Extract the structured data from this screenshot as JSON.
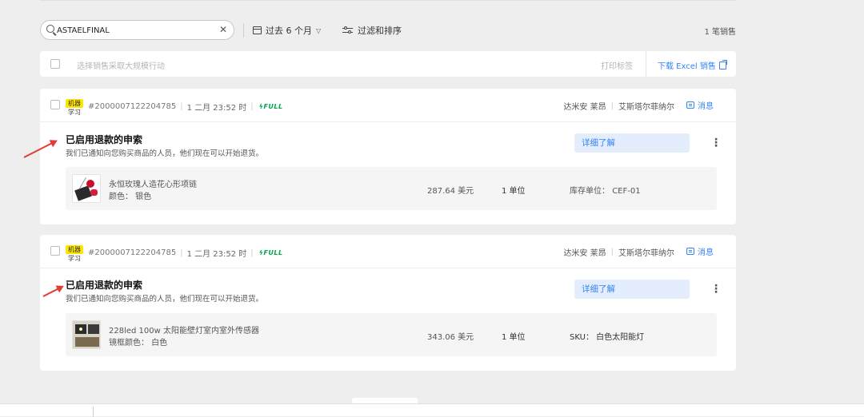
{
  "search": {
    "value": "ASTAELFINAL",
    "placeholder": ""
  },
  "period": {
    "label": "过去 6 个月"
  },
  "filter": {
    "label": "过滤和排序"
  },
  "sales_count": "1 笔销售",
  "bulk": {
    "hint": "选择销售采取大规模行动",
    "print_label": "打印标签",
    "excel_label": "下载 Excel 销售"
  },
  "orders": [
    {
      "tag_top": "机器",
      "tag_bottom": "学习",
      "order_number": "#2000007122204785",
      "datetime": "1 二月 23:52 时",
      "shipping": "FULL",
      "buyer_name": "达米安 莱昂",
      "buyer_alt": "艾斯塔尔菲纳尔",
      "message_label": "消息",
      "claim_title": "已启用退款的申索",
      "claim_desc": "我们已通知向您购买商品的人员，他们现在可以开始退货。",
      "learn_label": "详细了解",
      "item": {
        "name": "永恒玫瑰人造花心形项链",
        "variation": "颜色： 银色",
        "price": "287.64 美元",
        "units": "1 单位",
        "sku_label": "库存单位：",
        "sku_value": "CEF-01"
      }
    },
    {
      "tag_top": "机器",
      "tag_bottom": "学习",
      "order_number": "#2000007122204785",
      "datetime": "1 二月 23:52 时",
      "shipping": "FULL",
      "buyer_name": "达米安 莱昂",
      "buyer_alt": "艾斯塔尔菲纳尔",
      "message_label": "消息",
      "claim_title": "已启用退款的申索",
      "claim_desc": "我们已通知向您购买商品的人员，他们现在可以开始退货。",
      "learn_label": "详细了解",
      "item": {
        "name": "228led 100w 太阳能壁灯室内室外传感器",
        "variation": "镜框颜色： 白色",
        "price": "343.06 美元",
        "units": "1 单位",
        "sku_label": "SKU：",
        "sku_value": "白色太阳能灯"
      }
    }
  ],
  "colors": {
    "accent": "#3483fa",
    "full": "#00a650",
    "tag": "#ffe600",
    "arrow": "#e53935"
  }
}
